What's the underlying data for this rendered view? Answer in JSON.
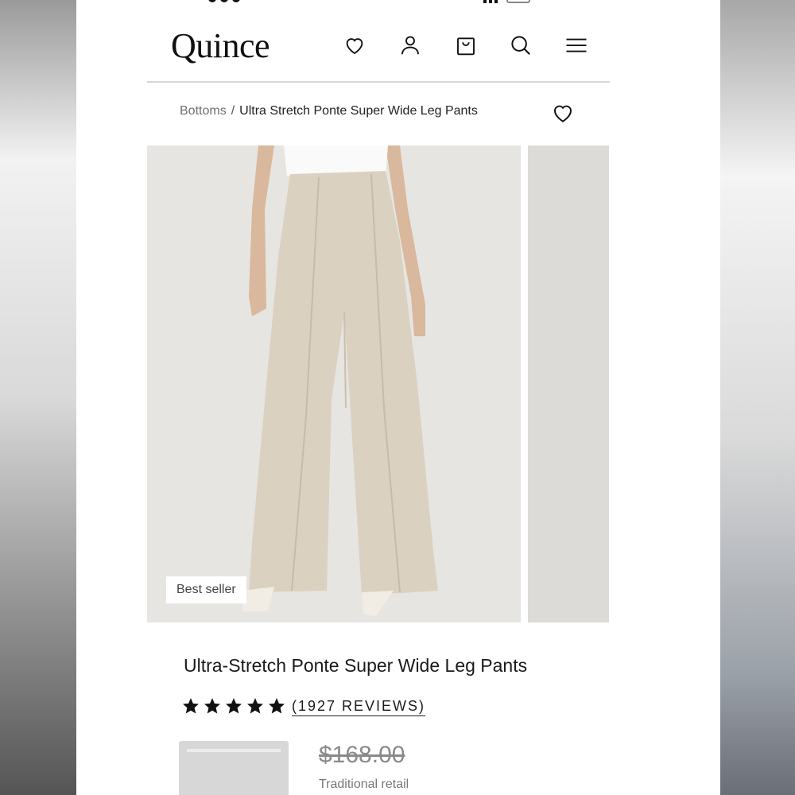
{
  "header": {
    "logo": "Quince"
  },
  "breadcrumb": {
    "parent": "Bottoms",
    "separator": "/",
    "current": "Ultra Stretch Ponte Super Wide Leg Pants"
  },
  "gallery": {
    "badge": "Best seller"
  },
  "product": {
    "title": "Ultra-Stretch Ponte Super Wide Leg Pants",
    "rating_stars": 5,
    "reviews_label": "(1927 REVIEWS)",
    "price_original": "$168.00",
    "price_label": "Traditional retail"
  },
  "icons": {
    "wishlist": "heart-icon",
    "account": "user-icon",
    "cart": "shopping-bag-icon",
    "search": "search-icon",
    "menu": "hamburger-menu-icon"
  },
  "colors": {
    "pants": "#dcd2c2",
    "background": "#e9e8e4",
    "text": "#1a1a1a"
  }
}
